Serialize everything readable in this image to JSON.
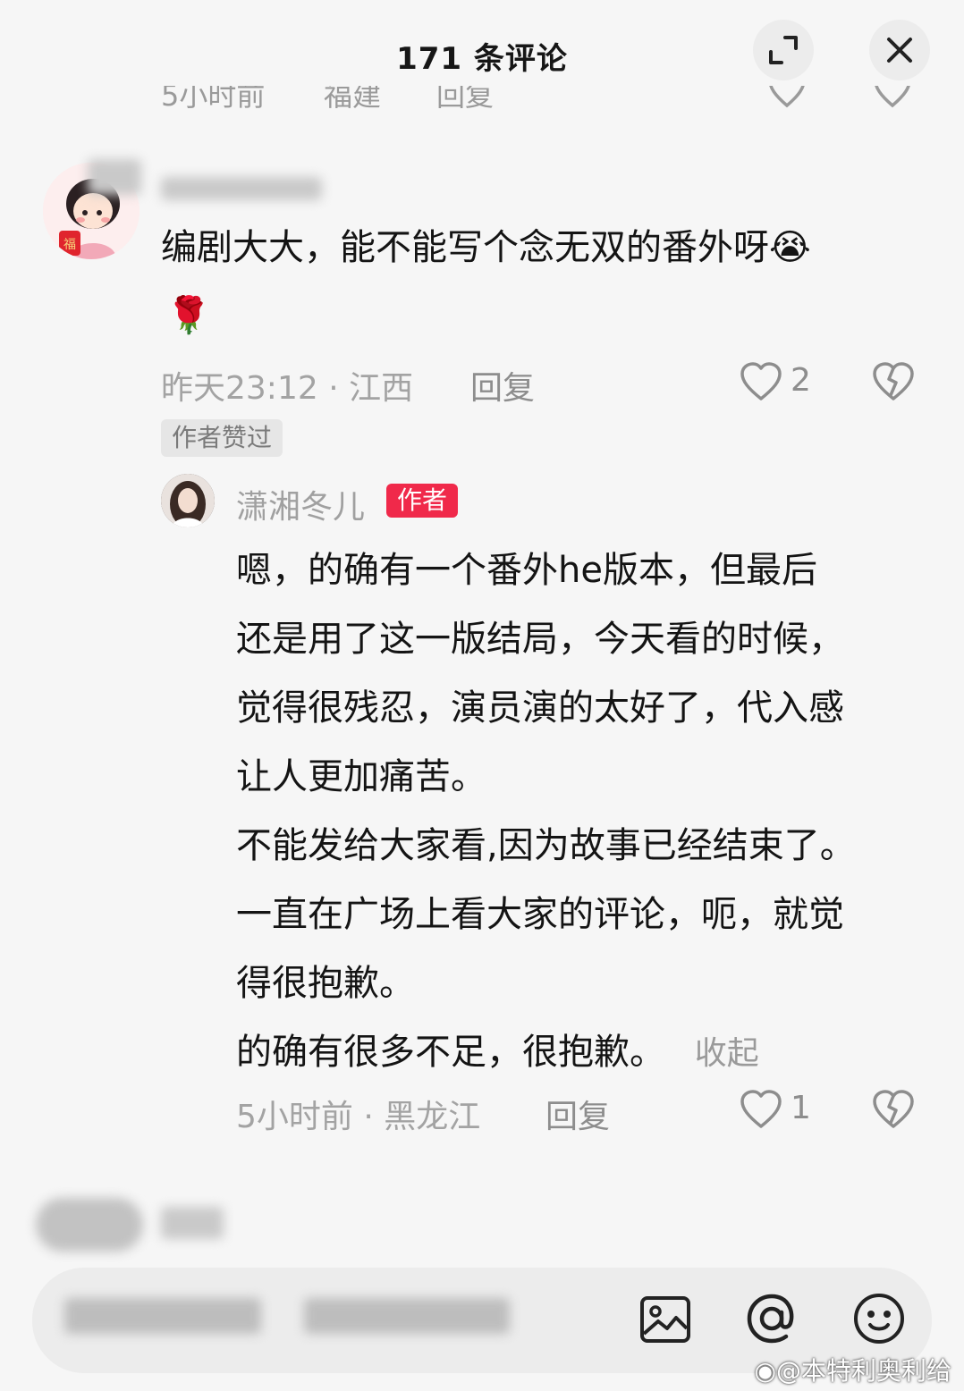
{
  "header": {
    "title": "171 条评论"
  },
  "previous_comment": {
    "time": "5小时前",
    "location": "福建",
    "reply": "回复"
  },
  "comment": {
    "text_line1": "编剧大大，能不能写个念无双的番外呀",
    "emoji1": "😭",
    "emoji2": "🌹",
    "time_location": "昨天23:12 · 江西",
    "reply": "回复",
    "likes": "2",
    "author_liked_tag": "作者赞过"
  },
  "author_reply": {
    "name": "潇湘冬儿",
    "badge": "作者",
    "lines": [
      "嗯，的确有一个番外he版本，但最后",
      "还是用了这一版结局，今天看的时候，",
      "觉得很残忍，演员演的太好了，代入感",
      "让人更加痛苦。",
      "不能发给大家看,因为故事已经结束了。",
      "一直在广场上看大家的评论，呃，就觉",
      "得很抱歉。",
      "的确有很多不足，很抱歉。"
    ],
    "collapse": "收起",
    "time_location": "5小时前 · 黑龙江",
    "reply": "回复",
    "likes": "1"
  },
  "watermark": "@本特利奥利给",
  "icons": [
    "expand-icon",
    "close-icon",
    "heart-icon",
    "dislike-icon",
    "image-icon",
    "at-icon",
    "emoji-icon",
    "weibo-icon"
  ]
}
